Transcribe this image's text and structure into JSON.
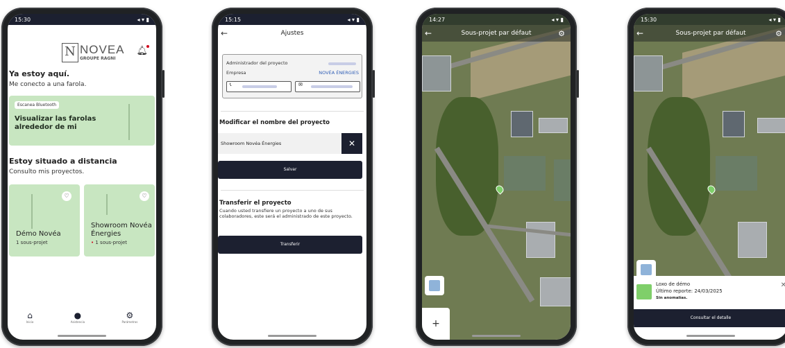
{
  "phone1": {
    "status_time": "15:30",
    "logo": {
      "brand": "NOVEA",
      "group": "GROUPE RAGNI"
    },
    "greeting_title": "Ya estoy aquí.",
    "greeting_sub": "Me conecto a una farola.",
    "bt_card": {
      "chip": "Escanea Bluetooth",
      "title": "Visualizar las farolas alrededor de mi"
    },
    "remote_title": "Estoy situado a distancia",
    "remote_sub": "Consulto mis proyectos.",
    "projects": [
      {
        "name": "Démo Novéa",
        "sub": "1 sous-projet"
      },
      {
        "name": "Showroom Novéa Énergies",
        "sub": "1 sous-projet"
      }
    ],
    "nav": [
      "Inicio",
      "Asistencia",
      "Parámetros"
    ]
  },
  "phone2": {
    "status_time": "15:15",
    "title": "Ajustes",
    "admin_label": "Administrador del proyecto",
    "company_label": "Empresa",
    "company_value": "NOVÉA ÉNERGIES",
    "rename_label": "Modificar el nombre del proyecto",
    "project_name": "Showroom Novéa Énergies",
    "save_label": "Salvar",
    "transfer_title": "Transferir el proyecto",
    "transfer_text": "Cuando usted transfiere un proyecto a uno de sus colaboradores, este será el administrado de este proyecto.",
    "transfer_button": "Transferir"
  },
  "phone3": {
    "status_time": "14:27",
    "title": "Sous-projet par défaut"
  },
  "phone4": {
    "status_time": "15:30",
    "title": "Sous-projet par défaut",
    "sheet": {
      "name": "Loxo de démo",
      "report": "Último reporte: 24/03/2025",
      "status": "Sin anomalías.",
      "button": "Consultar el detalle"
    }
  },
  "colors": {
    "navy": "#1c2030",
    "green_card": "#c8e6c1",
    "pin": "#7fcf6a",
    "link": "#2f5db5"
  }
}
